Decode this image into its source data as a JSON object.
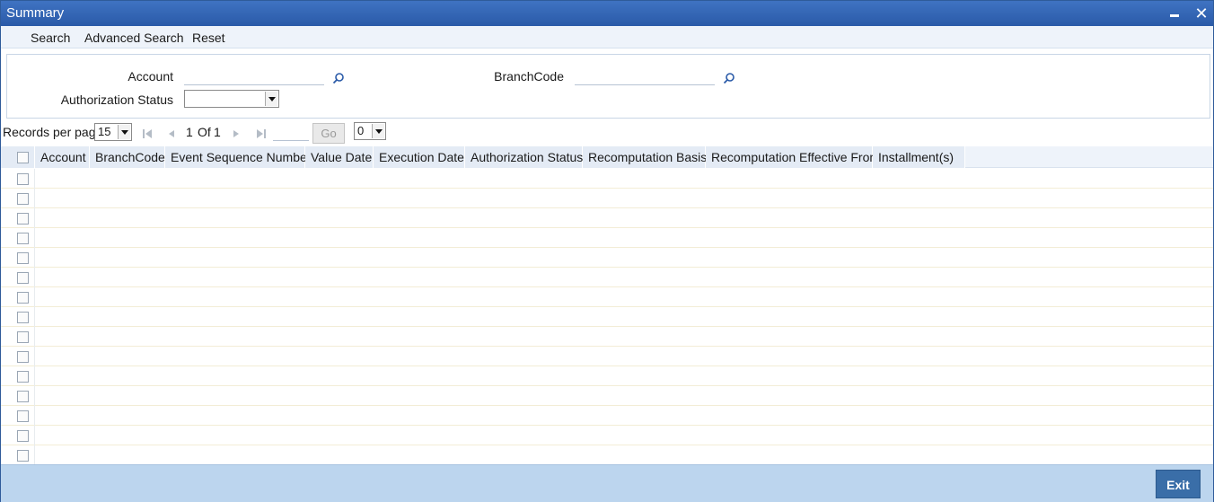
{
  "window": {
    "title": "Summary"
  },
  "menu": {
    "items": [
      "Search",
      "Advanced Search",
      "Reset"
    ]
  },
  "criteria": {
    "account_label": "Account",
    "account_value": "",
    "branchcode_label": "BranchCode",
    "branchcode_value": "",
    "auth_status_label": "Authorization Status",
    "auth_status_value": ""
  },
  "pager": {
    "records_per_page_label": "Records per page",
    "records_per_page_value": "15",
    "page_current": "1",
    "page_of": "Of",
    "page_total": "1",
    "goto_value": "",
    "go_label": "Go",
    "select_value": "0"
  },
  "grid": {
    "columns": [
      "Account",
      "BranchCode",
      "Event Sequence Number",
      "Value Date",
      "Execution Date",
      "Authorization Status",
      "Recomputation Basis",
      "Recomputation Effective From",
      "Installment(s)"
    ],
    "row_count": 15
  },
  "footer": {
    "exit_label": "Exit"
  },
  "icons": {
    "search": "search-icon",
    "first": "first-page-icon",
    "prev": "prev-page-icon",
    "next": "next-page-icon",
    "last": "last-page-icon"
  },
  "colors": {
    "titlebar": "#2f62b2",
    "footer": "#bcd5ee",
    "exit_button": "#3a6ea8"
  }
}
